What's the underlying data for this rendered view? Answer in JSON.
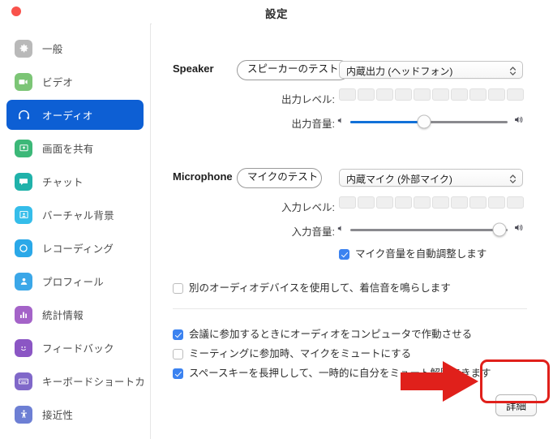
{
  "window": {
    "title": "設定",
    "close_button_label": "閉じる"
  },
  "sidebar": {
    "items": [
      {
        "label": "一般",
        "icon": "gear-icon",
        "color": "#b9b9b9",
        "selected": false
      },
      {
        "label": "ビデオ",
        "icon": "video-camera-icon",
        "color": "#7cc576",
        "selected": false
      },
      {
        "label": "オーディオ",
        "icon": "headphones-icon",
        "color": "#0d5fd4",
        "selected": true
      },
      {
        "label": "画面を共有",
        "icon": "screen-share-icon",
        "color": "#3cb878",
        "selected": false
      },
      {
        "label": "チャット",
        "icon": "chat-bubble-icon",
        "color": "#20b2aa",
        "selected": false
      },
      {
        "label": "バーチャル背景",
        "icon": "virtual-background-icon",
        "color": "#35bdea",
        "selected": false
      },
      {
        "label": "レコーディング",
        "icon": "record-circle-icon",
        "color": "#2aa8e8",
        "selected": false
      },
      {
        "label": "プロフィール",
        "icon": "person-icon",
        "color": "#3ba7e8",
        "selected": false
      },
      {
        "label": "統計情報",
        "icon": "bar-chart-icon",
        "color": "#a463c8",
        "selected": false
      },
      {
        "label": "フィードバック",
        "icon": "smiley-face-icon",
        "color": "#8b56c4",
        "selected": false
      },
      {
        "label": "キーボードショートカ…",
        "icon": "keyboard-icon",
        "color": "#8068c9",
        "selected": false
      },
      {
        "label": "接近性",
        "icon": "accessibility-icon",
        "color": "#6d7fd4",
        "selected": false
      }
    ]
  },
  "audio": {
    "speaker": {
      "section_label": "Speaker",
      "test_button": "スピーカーのテスト",
      "device_selected": "内蔵出力 (ヘッドフォン)",
      "output_level_label": "出力レベル:",
      "output_level_segments": 10,
      "output_level_active": 0,
      "output_volume_label": "出力音量:",
      "output_volume_percent": 47
    },
    "microphone": {
      "section_label": "Microphone",
      "test_button": "マイクのテスト",
      "device_selected": "内蔵マイク (外部マイク)",
      "input_level_label": "入力レベル:",
      "input_level_segments": 10,
      "input_level_active": 0,
      "input_volume_label": "入力音量:",
      "input_volume_percent": 95,
      "auto_adjust_label": "マイク音量を自動調整します",
      "auto_adjust_checked": true
    },
    "options": [
      {
        "label": "別のオーディオデバイスを使用して、着信音を鳴らします",
        "checked": false
      },
      {
        "label": "会議に参加するときにオーディオをコンピュータで作動させる",
        "checked": true
      },
      {
        "label": "ミーティングに参加時、マイクをミュートにする",
        "checked": false
      },
      {
        "label": "スペースキーを長押しして、一時的に自分をミュート解除できます",
        "checked": true
      }
    ],
    "advanced_button": "詳細"
  },
  "annotation": {
    "highlight_color": "#e0201b",
    "arrow_color": "#e0201b",
    "target": "詳細"
  }
}
